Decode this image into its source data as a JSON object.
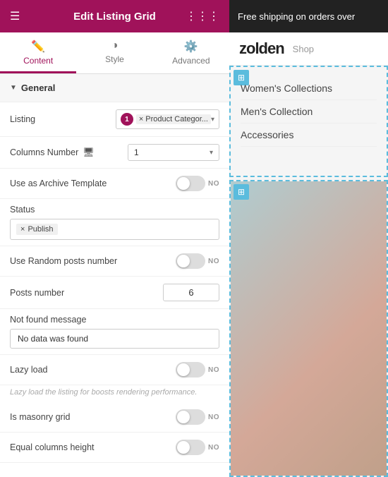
{
  "header": {
    "title": "Edit Listing Grid",
    "hamburger": "☰",
    "grid": "⋮⋮⋮",
    "banner": "Free shipping on orders over"
  },
  "tabs": [
    {
      "id": "content",
      "label": "Content",
      "icon": "✏️",
      "active": true
    },
    {
      "id": "style",
      "label": "Style",
      "icon": "◑",
      "active": false
    },
    {
      "id": "advanced",
      "label": "Advanced",
      "icon": "⚙️",
      "active": false
    }
  ],
  "general": {
    "section_label": "General",
    "fields": {
      "listing": {
        "label": "Listing",
        "badge": "1",
        "value": "Product Categor...",
        "remove": "×"
      },
      "columns_number": {
        "label": "Columns Number",
        "value": "1"
      },
      "use_as_archive": {
        "label": "Use as Archive Template",
        "value": "NO"
      },
      "status": {
        "label": "Status",
        "tag": "Publish",
        "remove": "×"
      },
      "use_random_posts": {
        "label": "Use Random posts number",
        "value": "NO"
      },
      "posts_number": {
        "label": "Posts number",
        "value": "6"
      },
      "not_found_message": {
        "label": "Not found message",
        "value": "No data was found"
      },
      "lazy_load": {
        "label": "Lazy load",
        "value": "NO",
        "helper": "Lazy load the listing for boosts rendering performance."
      },
      "is_masonry": {
        "label": "Is masonry grid",
        "value": "NO"
      },
      "equal_columns": {
        "label": "Equal columns height",
        "value": "NO"
      }
    }
  },
  "preview": {
    "logo": "zolden",
    "nav": "Shop",
    "collections": [
      "Women's Collections",
      "Men's Collection",
      "Accessories"
    ]
  }
}
